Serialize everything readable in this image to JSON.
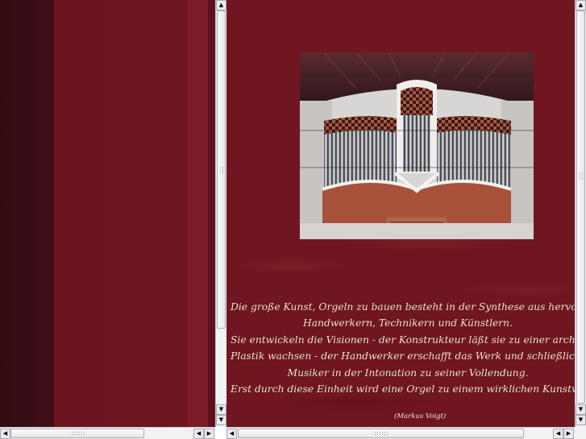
{
  "left_frame": {
    "colors": {
      "dark": "#3a0c12",
      "mid": "#6e1620",
      "highlight": "#7a1a26"
    }
  },
  "right_frame": {
    "photo": {
      "subject": "pipe-organ",
      "alt": "organ-photo"
    },
    "quote_lines": [
      "Die große Kunst, Orgeln zu bauen besteht in der Synthese aus hervorragenden",
      "Handwerkern, Technikern und Künstlern.",
      "Sie entwickeln die Visionen - der Konstrukteur läßt sie zu einer architektonischen",
      "Plastik wachsen - der Handwerker erschafft das Werk und schließlich bringt der",
      "Musiker in der Intonation zu seiner Vollendung.",
      "Erst durch diese Einheit wird eine Orgel zu einem wirklichen Kunstwerk."
    ],
    "author": "(Markus Voigt)",
    "colors": {
      "background": "#6f1620",
      "text": "#f3e4c8"
    }
  },
  "scrollbars": {
    "icons": {
      "up": "▲",
      "down": "▼",
      "left": "◀",
      "right": "▶"
    }
  }
}
